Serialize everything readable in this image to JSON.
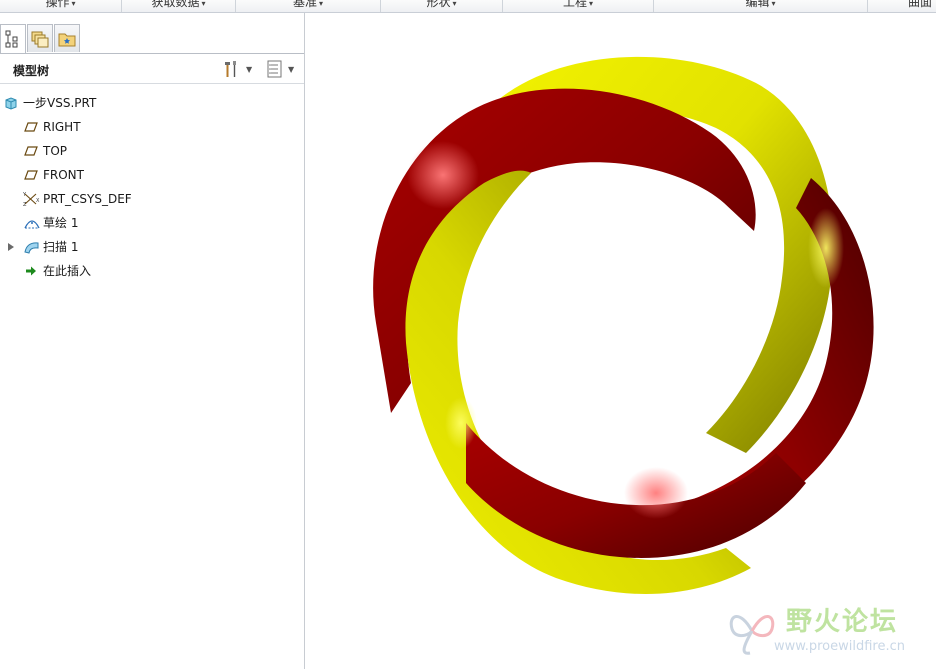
{
  "ribbon": {
    "groups": [
      {
        "label": "操作",
        "caret": "▾"
      },
      {
        "label": "获取数据",
        "caret": "▾"
      },
      {
        "label": "基准",
        "caret": "▾"
      },
      {
        "label": "形状",
        "caret": "▾"
      },
      {
        "label": "工程",
        "caret": "▾"
      },
      {
        "label": "编辑",
        "caret": "▾"
      },
      {
        "label": "曲面",
        "caret": ""
      }
    ]
  },
  "panel": {
    "tabs": [
      {
        "icon": "model-tree-icon",
        "active": true
      },
      {
        "icon": "layers-icon",
        "active": false
      },
      {
        "icon": "favorites-folder-icon",
        "active": false
      }
    ],
    "header": {
      "title": "模型树",
      "settings_icon": "tools-icon",
      "show_icon": "list-settings-icon"
    },
    "tree": [
      {
        "label": "一步VSS.PRT",
        "icon": "part-icon",
        "indent": 0,
        "expandable": false
      },
      {
        "label": "RIGHT",
        "icon": "datum-plane-icon",
        "indent": 1,
        "expandable": false
      },
      {
        "label": "TOP",
        "icon": "datum-plane-icon",
        "indent": 1,
        "expandable": false
      },
      {
        "label": "FRONT",
        "icon": "datum-plane-icon",
        "indent": 1,
        "expandable": false
      },
      {
        "label": "PRT_CSYS_DEF",
        "icon": "coordinate-system-icon",
        "indent": 1,
        "expandable": false
      },
      {
        "label": "草绘 1",
        "icon": "sketch-icon",
        "indent": 1,
        "expandable": false
      },
      {
        "label": "扫描 1",
        "icon": "sweep-icon",
        "indent": 1,
        "expandable": true
      },
      {
        "label": "在此插入",
        "icon": "insert-here-arrow-icon",
        "indent": 1,
        "expandable": false
      }
    ]
  },
  "viewport": {
    "model": "twisted-ring",
    "colors": {
      "yellow": "#e4e400",
      "red": "#8a0000",
      "background": "#ffffff"
    }
  },
  "watermark": {
    "brand": "野火论坛",
    "url": "www.proewildfire.cn"
  }
}
